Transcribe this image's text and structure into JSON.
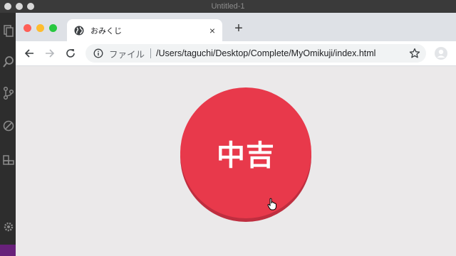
{
  "editor": {
    "title": "Untitled-1"
  },
  "browser": {
    "tab": {
      "title": "おみくじ",
      "close_glyph": "×",
      "favicon": "globe-icon"
    },
    "new_tab_glyph": "+",
    "toolbar": {
      "back_icon": "arrow-left-icon",
      "forward_icon": "arrow-right-icon",
      "reload_icon": "reload-icon",
      "scheme_label": "ファイル",
      "url": "/Users/taguchi/Desktop/Complete/MyOmikuji/index.html",
      "bookmark_icon": "star-icon"
    }
  },
  "page": {
    "omikuji_result": "中吉",
    "button_color": "#e8394b",
    "background_color": "#ebe9ea"
  },
  "colors": {
    "traffic_red": "#fe5f57",
    "traffic_yellow": "#febc2e",
    "traffic_green": "#28c840",
    "editor_accent": "#68217a"
  }
}
